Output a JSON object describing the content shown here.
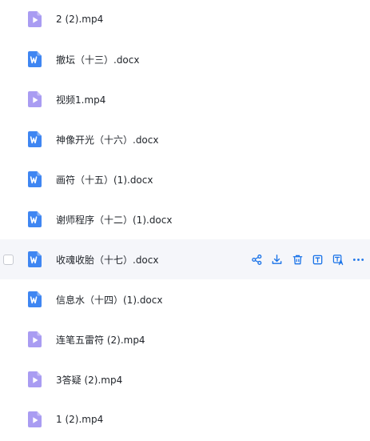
{
  "files": [
    {
      "name": "2 (2).mp4",
      "type": "video",
      "icon": "video-file-icon"
    },
    {
      "name": "撤坛（十三）.docx",
      "type": "doc",
      "icon": "word-file-icon"
    },
    {
      "name": "视频1.mp4",
      "type": "video",
      "icon": "video-file-icon"
    },
    {
      "name": "神像开光（十六）.docx",
      "type": "doc",
      "icon": "word-file-icon"
    },
    {
      "name": "画符（十五）(1).docx",
      "type": "doc",
      "icon": "word-file-icon"
    },
    {
      "name": "谢师程序（十二）(1).docx",
      "type": "doc",
      "icon": "word-file-icon"
    },
    {
      "name": "收魂收胎（十七）.docx",
      "type": "doc",
      "icon": "word-file-icon",
      "hovered": true
    },
    {
      "name": "信息水（十四）(1).docx",
      "type": "doc",
      "icon": "word-file-icon"
    },
    {
      "name": "连笔五雷符 (2).mp4",
      "type": "video",
      "icon": "video-file-icon"
    },
    {
      "name": "3答疑 (2).mp4",
      "type": "video",
      "icon": "video-file-icon"
    },
    {
      "name": "1 (2).mp4",
      "type": "video",
      "icon": "video-file-icon"
    }
  ],
  "row_actions": [
    {
      "name": "share-icon"
    },
    {
      "name": "download-icon"
    },
    {
      "name": "delete-icon"
    },
    {
      "name": "text-extract-icon"
    },
    {
      "name": "translate-icon"
    },
    {
      "name": "more-icon"
    }
  ],
  "colors": {
    "accent": "#1a73e8",
    "video_icon": "#a99cf2",
    "doc_icon": "#3f86f2",
    "hover_row": "#f5f6fa",
    "text": "#1f2329"
  }
}
